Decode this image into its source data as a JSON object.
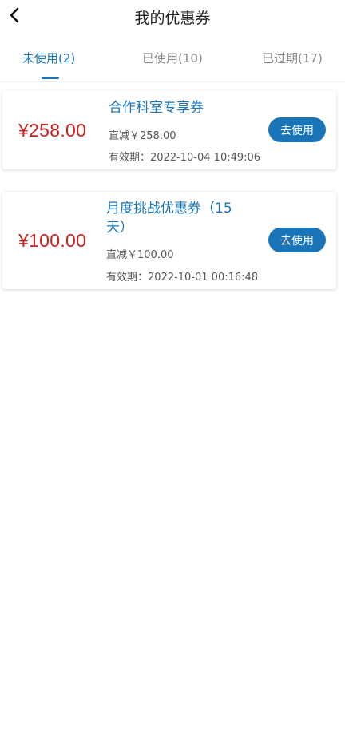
{
  "header": {
    "title": "我的优惠券",
    "back_icon": "chevron-left-icon"
  },
  "tabs": [
    {
      "label": "未使用(2)",
      "active": true
    },
    {
      "label": "已使用(10)",
      "active": false
    },
    {
      "label": "已过期(17)",
      "active": false
    }
  ],
  "coupons": [
    {
      "amount": "¥258.00",
      "title": "合作科室专享券",
      "deduction": "直减￥258.00",
      "validity": "有效期：2022-10-04 10:49:06",
      "button_label": "去使用"
    },
    {
      "amount": "¥100.00",
      "title": "月度挑战优惠券（15天）",
      "deduction": "直减￥100.00",
      "validity": "有效期：2022-10-01 00:16:48",
      "button_label": "去使用"
    }
  ],
  "colors": {
    "accent": "#1a75b8",
    "amount": "#cc1f1f"
  }
}
